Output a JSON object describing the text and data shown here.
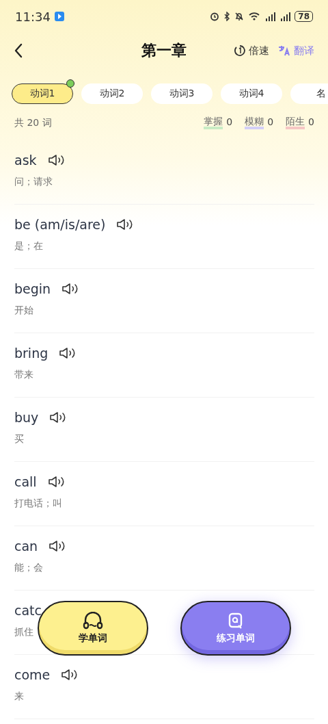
{
  "status_bar": {
    "time": "11:34",
    "battery": "78"
  },
  "header": {
    "title": "第一章",
    "speed_label": "倍速",
    "translate_label": "翻译"
  },
  "tabs": [
    {
      "label": "动词1",
      "selected": true,
      "dot": true
    },
    {
      "label": "动词2",
      "selected": false,
      "dot": false
    },
    {
      "label": "动词3",
      "selected": false,
      "dot": false
    },
    {
      "label": "动词4",
      "selected": false,
      "dot": false
    },
    {
      "label": "名",
      "selected": false,
      "dot": false
    }
  ],
  "summary": {
    "total": "共 20 词",
    "stats": [
      {
        "label": "掌握",
        "count": "0",
        "color": "#c9ecc4"
      },
      {
        "label": "模糊",
        "count": "0",
        "color": "#d3cff7"
      },
      {
        "label": "陌生",
        "count": "0",
        "color": "#f6c7c4"
      }
    ]
  },
  "words": [
    {
      "word": "ask",
      "meaning": "问；请求",
      "audio": true
    },
    {
      "word": "be (am/is/are)",
      "meaning": "是；在",
      "audio": true
    },
    {
      "word": "begin",
      "meaning": "开始",
      "audio": true
    },
    {
      "word": "bring",
      "meaning": "带来",
      "audio": true
    },
    {
      "word": "buy",
      "meaning": "买",
      "audio": true
    },
    {
      "word": "call",
      "meaning": "打电话；叫",
      "audio": true
    },
    {
      "word": "can",
      "meaning": "能；会",
      "audio": true
    },
    {
      "word": "catc",
      "meaning": "抓住"
    },
    {
      "word": "come",
      "meaning": "来",
      "audio": true
    }
  ],
  "actions": [
    {
      "label": "学单词",
      "kind": "study"
    },
    {
      "label": "练习单词",
      "kind": "practice"
    }
  ]
}
